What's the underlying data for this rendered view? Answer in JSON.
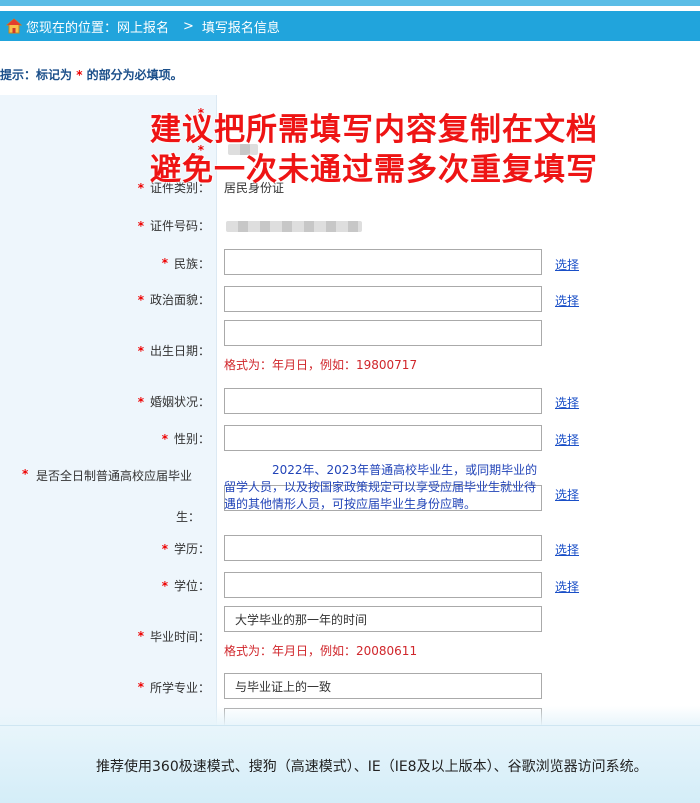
{
  "breadcrumb": {
    "prefix": "您现在的位置：网上报名",
    "sep": ">",
    "current": "填写报名信息"
  },
  "hint": {
    "before": "提示：标记为",
    "star": "*",
    "after": "的部分为必填项。"
  },
  "overlay": {
    "line1": "建议把所需填写内容复制在文档",
    "line2": "避免一次未通过需多次重复填写"
  },
  "fields": {
    "star": "*",
    "id_type_label": "证件类别：",
    "id_type_value": "居民身份证",
    "id_no_label": "证件号码：",
    "ethnic_label": "民族：",
    "political_label": "政治面貌：",
    "birth_label": "出生日期：",
    "birth_format": "格式为：年月日，例如：19800717",
    "marital_label": "婚姻状况：",
    "gender_label": "性别：",
    "fresh_label_1": "是否全日制普通高校应届毕业",
    "fresh_label_2": "生：",
    "fresh_note": "2022年、2023年普通高校毕业生，或同期毕业的留学人员，以及按国家政策规定可以享受应届毕业生就业待遇的其他情形人员，可按应届毕业生身份应聘。",
    "education_label": "学历：",
    "degree_label": "学位：",
    "grad_time_label": "毕业时间：",
    "grad_time_value": "大学毕业的那一年的时间",
    "grad_format": "格式为：年月日，例如：20080611",
    "major_label": "所学专业：",
    "major_value": "与毕业证上的一致",
    "select_link": "选择"
  },
  "footer": {
    "text": "推荐使用360极速模式、搜狗（高速模式）、IE（IE8及以上版本）、谷歌浏览器访问系统。"
  },
  "colors": {
    "breadcrumb_bg": "#21a4dc",
    "label_bg": "#eef6fc",
    "required_star": "#e00000",
    "overlay_text": "#ee1414",
    "link": "#1a4fc7",
    "format_hint": "#d0262b"
  }
}
